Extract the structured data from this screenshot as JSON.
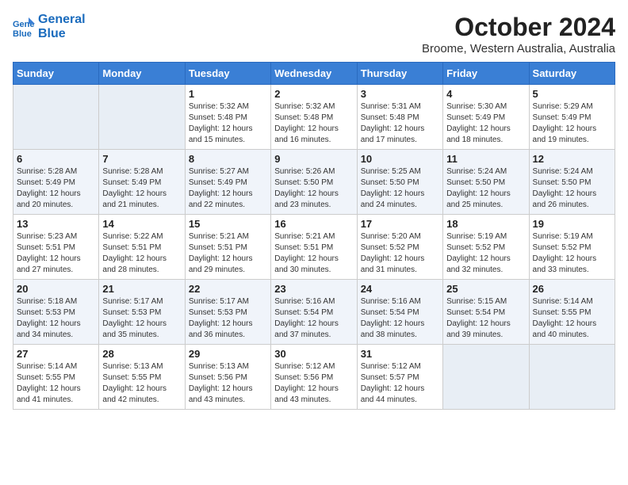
{
  "logo": {
    "line1": "General",
    "line2": "Blue"
  },
  "title": "October 2024",
  "subtitle": "Broome, Western Australia, Australia",
  "days_of_week": [
    "Sunday",
    "Monday",
    "Tuesday",
    "Wednesday",
    "Thursday",
    "Friday",
    "Saturday"
  ],
  "weeks": [
    [
      {
        "day": "",
        "sunrise": "",
        "sunset": "",
        "daylight": ""
      },
      {
        "day": "",
        "sunrise": "",
        "sunset": "",
        "daylight": ""
      },
      {
        "day": "1",
        "sunrise": "Sunrise: 5:32 AM",
        "sunset": "Sunset: 5:48 PM",
        "daylight": "Daylight: 12 hours and 15 minutes."
      },
      {
        "day": "2",
        "sunrise": "Sunrise: 5:32 AM",
        "sunset": "Sunset: 5:48 PM",
        "daylight": "Daylight: 12 hours and 16 minutes."
      },
      {
        "day": "3",
        "sunrise": "Sunrise: 5:31 AM",
        "sunset": "Sunset: 5:48 PM",
        "daylight": "Daylight: 12 hours and 17 minutes."
      },
      {
        "day": "4",
        "sunrise": "Sunrise: 5:30 AM",
        "sunset": "Sunset: 5:49 PM",
        "daylight": "Daylight: 12 hours and 18 minutes."
      },
      {
        "day": "5",
        "sunrise": "Sunrise: 5:29 AM",
        "sunset": "Sunset: 5:49 PM",
        "daylight": "Daylight: 12 hours and 19 minutes."
      }
    ],
    [
      {
        "day": "6",
        "sunrise": "Sunrise: 5:28 AM",
        "sunset": "Sunset: 5:49 PM",
        "daylight": "Daylight: 12 hours and 20 minutes."
      },
      {
        "day": "7",
        "sunrise": "Sunrise: 5:28 AM",
        "sunset": "Sunset: 5:49 PM",
        "daylight": "Daylight: 12 hours and 21 minutes."
      },
      {
        "day": "8",
        "sunrise": "Sunrise: 5:27 AM",
        "sunset": "Sunset: 5:49 PM",
        "daylight": "Daylight: 12 hours and 22 minutes."
      },
      {
        "day": "9",
        "sunrise": "Sunrise: 5:26 AM",
        "sunset": "Sunset: 5:50 PM",
        "daylight": "Daylight: 12 hours and 23 minutes."
      },
      {
        "day": "10",
        "sunrise": "Sunrise: 5:25 AM",
        "sunset": "Sunset: 5:50 PM",
        "daylight": "Daylight: 12 hours and 24 minutes."
      },
      {
        "day": "11",
        "sunrise": "Sunrise: 5:24 AM",
        "sunset": "Sunset: 5:50 PM",
        "daylight": "Daylight: 12 hours and 25 minutes."
      },
      {
        "day": "12",
        "sunrise": "Sunrise: 5:24 AM",
        "sunset": "Sunset: 5:50 PM",
        "daylight": "Daylight: 12 hours and 26 minutes."
      }
    ],
    [
      {
        "day": "13",
        "sunrise": "Sunrise: 5:23 AM",
        "sunset": "Sunset: 5:51 PM",
        "daylight": "Daylight: 12 hours and 27 minutes."
      },
      {
        "day": "14",
        "sunrise": "Sunrise: 5:22 AM",
        "sunset": "Sunset: 5:51 PM",
        "daylight": "Daylight: 12 hours and 28 minutes."
      },
      {
        "day": "15",
        "sunrise": "Sunrise: 5:21 AM",
        "sunset": "Sunset: 5:51 PM",
        "daylight": "Daylight: 12 hours and 29 minutes."
      },
      {
        "day": "16",
        "sunrise": "Sunrise: 5:21 AM",
        "sunset": "Sunset: 5:51 PM",
        "daylight": "Daylight: 12 hours and 30 minutes."
      },
      {
        "day": "17",
        "sunrise": "Sunrise: 5:20 AM",
        "sunset": "Sunset: 5:52 PM",
        "daylight": "Daylight: 12 hours and 31 minutes."
      },
      {
        "day": "18",
        "sunrise": "Sunrise: 5:19 AM",
        "sunset": "Sunset: 5:52 PM",
        "daylight": "Daylight: 12 hours and 32 minutes."
      },
      {
        "day": "19",
        "sunrise": "Sunrise: 5:19 AM",
        "sunset": "Sunset: 5:52 PM",
        "daylight": "Daylight: 12 hours and 33 minutes."
      }
    ],
    [
      {
        "day": "20",
        "sunrise": "Sunrise: 5:18 AM",
        "sunset": "Sunset: 5:53 PM",
        "daylight": "Daylight: 12 hours and 34 minutes."
      },
      {
        "day": "21",
        "sunrise": "Sunrise: 5:17 AM",
        "sunset": "Sunset: 5:53 PM",
        "daylight": "Daylight: 12 hours and 35 minutes."
      },
      {
        "day": "22",
        "sunrise": "Sunrise: 5:17 AM",
        "sunset": "Sunset: 5:53 PM",
        "daylight": "Daylight: 12 hours and 36 minutes."
      },
      {
        "day": "23",
        "sunrise": "Sunrise: 5:16 AM",
        "sunset": "Sunset: 5:54 PM",
        "daylight": "Daylight: 12 hours and 37 minutes."
      },
      {
        "day": "24",
        "sunrise": "Sunrise: 5:16 AM",
        "sunset": "Sunset: 5:54 PM",
        "daylight": "Daylight: 12 hours and 38 minutes."
      },
      {
        "day": "25",
        "sunrise": "Sunrise: 5:15 AM",
        "sunset": "Sunset: 5:54 PM",
        "daylight": "Daylight: 12 hours and 39 minutes."
      },
      {
        "day": "26",
        "sunrise": "Sunrise: 5:14 AM",
        "sunset": "Sunset: 5:55 PM",
        "daylight": "Daylight: 12 hours and 40 minutes."
      }
    ],
    [
      {
        "day": "27",
        "sunrise": "Sunrise: 5:14 AM",
        "sunset": "Sunset: 5:55 PM",
        "daylight": "Daylight: 12 hours and 41 minutes."
      },
      {
        "day": "28",
        "sunrise": "Sunrise: 5:13 AM",
        "sunset": "Sunset: 5:55 PM",
        "daylight": "Daylight: 12 hours and 42 minutes."
      },
      {
        "day": "29",
        "sunrise": "Sunrise: 5:13 AM",
        "sunset": "Sunset: 5:56 PM",
        "daylight": "Daylight: 12 hours and 43 minutes."
      },
      {
        "day": "30",
        "sunrise": "Sunrise: 5:12 AM",
        "sunset": "Sunset: 5:56 PM",
        "daylight": "Daylight: 12 hours and 43 minutes."
      },
      {
        "day": "31",
        "sunrise": "Sunrise: 5:12 AM",
        "sunset": "Sunset: 5:57 PM",
        "daylight": "Daylight: 12 hours and 44 minutes."
      },
      {
        "day": "",
        "sunrise": "",
        "sunset": "",
        "daylight": ""
      },
      {
        "day": "",
        "sunrise": "",
        "sunset": "",
        "daylight": ""
      }
    ]
  ]
}
